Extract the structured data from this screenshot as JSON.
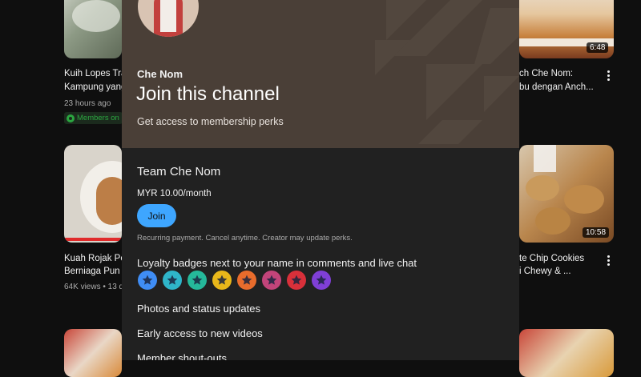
{
  "background": {
    "left": [
      {
        "title_line1": "Kuih Lopes Tra",
        "title_line2": "Kampung yang",
        "meta": "23 hours ago",
        "badge": "Members on"
      },
      {
        "title_line1": "Kuah Rojak Pe",
        "title_line2": "Berniaga Pun",
        "meta": "64K views • 13 d"
      }
    ],
    "right": [
      {
        "title_line1": "ch Che Nom:",
        "title_line2": "bu dengan Anch...",
        "duration": "6:48"
      },
      {
        "title_line1": "te Chip Cookies",
        "title_line2": "i Chewy & ...",
        "duration": "10:58"
      }
    ]
  },
  "modal": {
    "channel_name": "Che Nom",
    "title": "Join this channel",
    "subtitle": "Get access to membership perks",
    "tier_name": "Team Che Nom",
    "price": "MYR 10.00/month",
    "join_label": "Join",
    "recurring_note": "Recurring payment. Cancel anytime. Creator may update perks.",
    "perks": [
      "Loyalty badges next to your name in comments and live chat",
      "Photos and status updates",
      "Early access to new videos",
      "Member shout-outs"
    ],
    "badge_colors": [
      "#3f8df5",
      "#2fb5c9",
      "#25b89a",
      "#e8b71a",
      "#e86c2c",
      "#c2447a",
      "#d8303a",
      "#7f3fd6"
    ]
  },
  "colors": {
    "header_bg": "#4a3f37",
    "modal_bg": "#212121",
    "accent": "#3ea6ff",
    "members_green": "#2ba640"
  }
}
